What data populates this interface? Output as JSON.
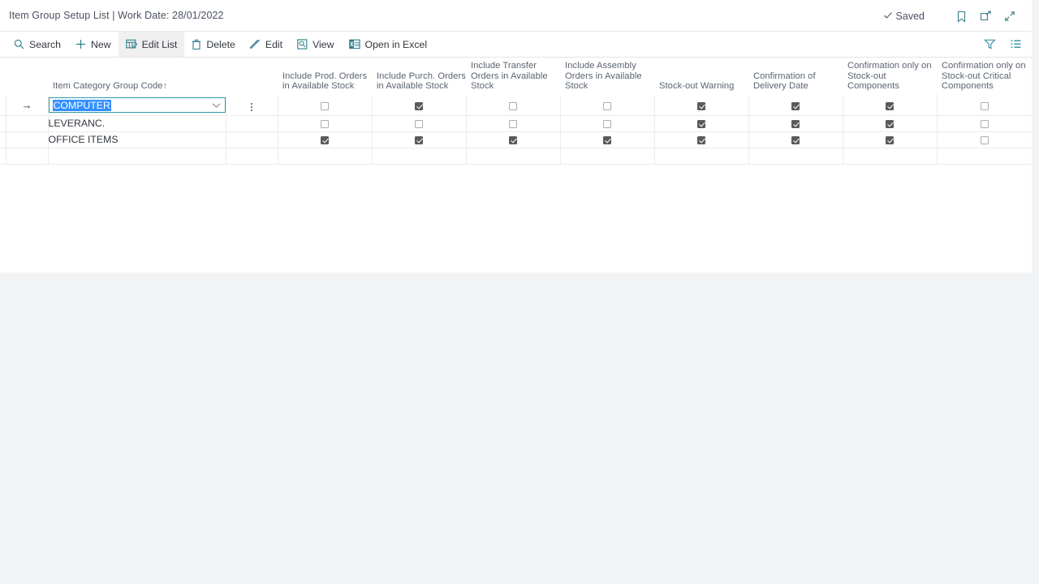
{
  "window": {
    "title": "Item Group Setup List | Work Date: 28/01/2022",
    "status_label": "Saved",
    "icons": {
      "check": "check-icon",
      "bookmark": "bookmark-icon",
      "open_new_window": "open-in-new-window-icon",
      "collapse": "collapse-icon"
    }
  },
  "toolbar": {
    "items": [
      {
        "label": "Search",
        "icon": "search-icon",
        "active": false
      },
      {
        "label": "New",
        "icon": "plus-icon",
        "active": false
      },
      {
        "label": "Edit List",
        "icon": "edit-list-icon",
        "active": true
      },
      {
        "label": "Delete",
        "icon": "trash-icon",
        "active": false
      },
      {
        "label": "Edit",
        "icon": "pencil-icon",
        "active": false
      },
      {
        "label": "View",
        "icon": "magnifier-page-icon",
        "active": false
      },
      {
        "label": "Open in Excel",
        "icon": "excel-icon",
        "active": false
      }
    ],
    "right_icons": [
      {
        "name": "filter-icon"
      },
      {
        "name": "list-options-icon"
      }
    ]
  },
  "grid": {
    "columns": [
      {
        "key": "name",
        "label": "Item Category Group Code",
        "sort": "↑"
      },
      {
        "key": "menu",
        "label": ""
      },
      {
        "key": "prod_orders",
        "label": "Include Prod. Orders in Available Stock"
      },
      {
        "key": "purch_orders",
        "label": "Include Purch. Orders in Available Stock"
      },
      {
        "key": "transfer_orders",
        "label": "Include Transfer Orders in Available Stock"
      },
      {
        "key": "assembly_orders",
        "label": "Include Assembly Orders in Available Stock"
      },
      {
        "key": "stockout_warning",
        "label": "Stock-out Warning"
      },
      {
        "key": "conf_delivery_date",
        "label": "Confirmation of Delivery Date"
      },
      {
        "key": "conf_stockout_components",
        "label": "Confirmation only on Stock-out Components"
      },
      {
        "key": "conf_stockout_critical",
        "label": "Confirmation only on Stock-out Critical Components"
      }
    ],
    "rows": [
      {
        "name": "COMPUTER",
        "selected": true,
        "indicator": "→",
        "prod_orders": false,
        "purch_orders": true,
        "transfer_orders": false,
        "assembly_orders": false,
        "stockout_warning": true,
        "conf_delivery_date": true,
        "conf_stockout_components": true,
        "conf_stockout_critical": false
      },
      {
        "name": "LEVERANC.",
        "selected": false,
        "indicator": "",
        "prod_orders": false,
        "purch_orders": false,
        "transfer_orders": false,
        "assembly_orders": false,
        "stockout_warning": true,
        "conf_delivery_date": true,
        "conf_stockout_components": true,
        "conf_stockout_critical": false
      },
      {
        "name": "OFFICE ITEMS",
        "selected": false,
        "indicator": "",
        "prod_orders": true,
        "purch_orders": true,
        "transfer_orders": true,
        "assembly_orders": true,
        "stockout_warning": true,
        "conf_delivery_date": true,
        "conf_stockout_components": true,
        "conf_stockout_critical": false
      },
      {
        "name": "",
        "selected": false,
        "indicator": "",
        "prod_orders": null,
        "purch_orders": null,
        "transfer_orders": null,
        "assembly_orders": null,
        "stockout_warning": null,
        "conf_delivery_date": null,
        "conf_stockout_components": null,
        "conf_stockout_critical": null
      }
    ]
  },
  "colors": {
    "accent_teal": "#2e7d8c",
    "selection_blue": "#3390ff",
    "active_cell_teal": "#addee4",
    "page_background": "#f2f3f5",
    "checkbox_checked": "#5a5a5a"
  }
}
